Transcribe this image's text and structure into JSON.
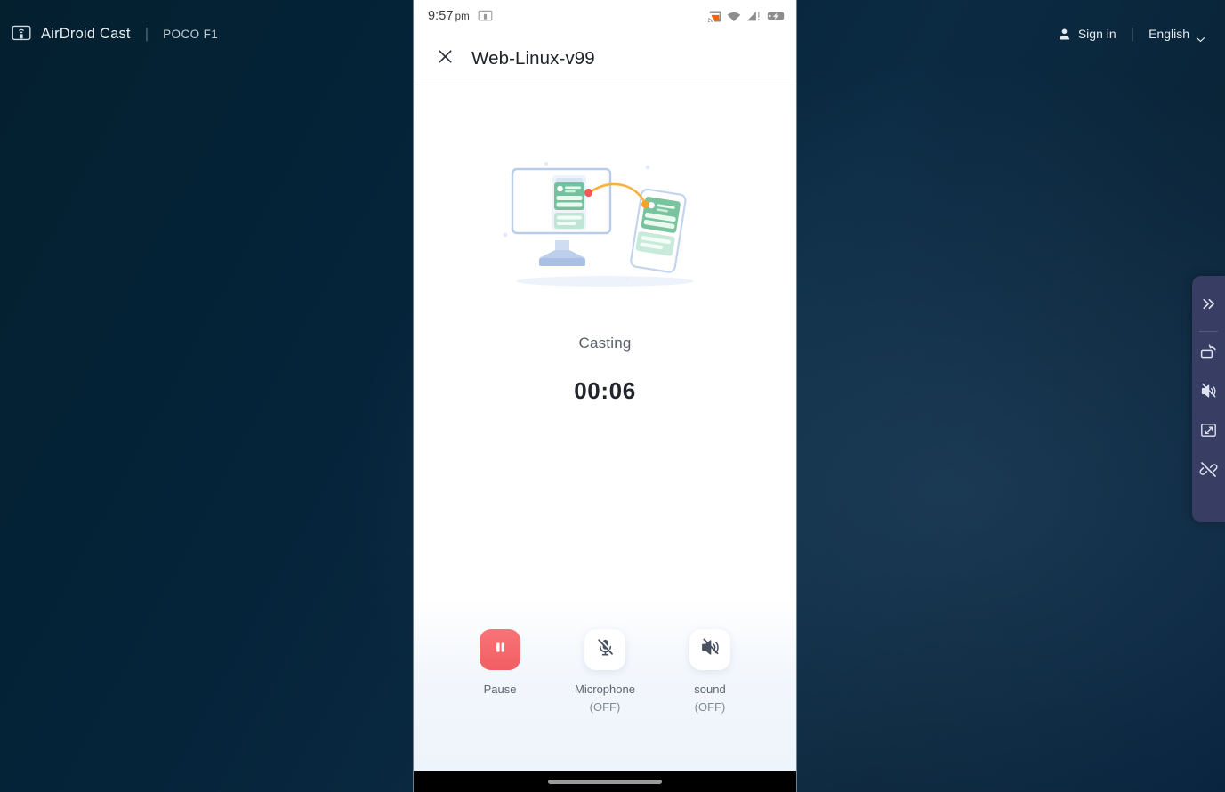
{
  "topbar": {
    "brand_icon": "cast-screen-icon",
    "brand_name": "AirDroid Cast",
    "separator": "|",
    "device_name": "POCO F1",
    "signin_icon": "person-icon",
    "signin_label": "Sign in",
    "signin_separator": "|",
    "language_label": "English",
    "language_chevron_icon": "chevron-down-icon"
  },
  "phone": {
    "statusbar": {
      "time": "9:57",
      "ampm": "pm",
      "left_icon": "screen-cast-icon",
      "right_icons": [
        "cast-active-icon",
        "wifi-icon",
        "cellular-signal-alert-icon",
        "battery-icon"
      ]
    },
    "titlebar": {
      "close_icon": "close-icon",
      "title": "Web-Linux-v99"
    },
    "content": {
      "illustration": "desktop-to-phone-casting-illustration",
      "status_text": "Casting",
      "timer": "00:06"
    },
    "controls": [
      {
        "name": "pause",
        "icon": "pause-icon",
        "label": "Pause",
        "sub": "",
        "style": "red"
      },
      {
        "name": "microphone",
        "icon": "microphone-muted-icon",
        "label": "Microphone",
        "sub": "(OFF)",
        "style": "white"
      },
      {
        "name": "sound",
        "icon": "speaker-muted-icon",
        "label": "sound",
        "sub": "(OFF)",
        "style": "white"
      }
    ],
    "navbar": {
      "home_indicator": "home-indicator"
    }
  },
  "float_toolbar": {
    "items": [
      {
        "name": "expand",
        "icon": "double-chevron-right-icon"
      },
      {
        "name": "rotate",
        "icon": "rotate-screen-icon"
      },
      {
        "name": "mute",
        "icon": "speaker-muted-icon"
      },
      {
        "name": "fullscreen",
        "icon": "fullscreen-icon"
      },
      {
        "name": "disconnect",
        "icon": "disconnect-icon"
      }
    ]
  },
  "colors": {
    "background_dark": "#05233a",
    "accent_red": "#f15e63",
    "toolbar": "#383d63",
    "cast_orange": "#fa6400"
  }
}
